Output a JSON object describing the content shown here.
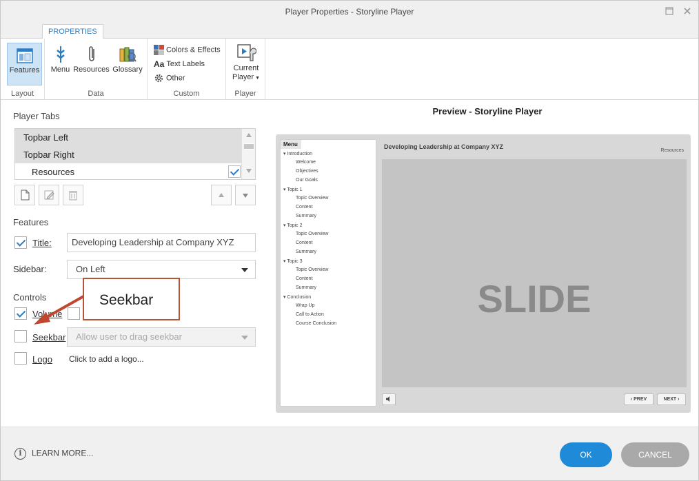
{
  "window": {
    "title": "Player Properties - Storyline Player"
  },
  "ribbon": {
    "tab": "PROPERTIES",
    "groups": {
      "layout": {
        "label": "Layout",
        "features": "Features"
      },
      "data": {
        "label": "Data",
        "menu": "Menu",
        "resources": "Resources",
        "glossary": "Glossary"
      },
      "custom": {
        "label": "Custom",
        "colors": "Colors & Effects",
        "text_labels": "Text Labels",
        "other": "Other"
      },
      "player": {
        "label": "Player",
        "current_line1": "Current",
        "current_line2": "Player"
      }
    }
  },
  "player_tabs": {
    "heading": "Player Tabs",
    "items": [
      {
        "label": "Topbar Left"
      },
      {
        "label": "Topbar Right"
      },
      {
        "label": "Resources"
      }
    ]
  },
  "features": {
    "heading": "Features",
    "title_label": "Title:",
    "title_value": "Developing Leadership at Company XYZ",
    "sidebar_label": "Sidebar:",
    "sidebar_value": "On Left"
  },
  "controls": {
    "heading": "Controls",
    "volume_label": "Volume",
    "seekbar_label": "Seekbar",
    "seekbar_option": "Allow user to drag seekbar",
    "logo_label": "Logo",
    "logo_hint": "Click to add a logo..."
  },
  "callout": {
    "text": "Seekbar"
  },
  "preview": {
    "heading": "Preview - Storyline Player",
    "menu_header": "Menu",
    "course_title": "Developing Leadership at Company XYZ",
    "resources_link": "Resources",
    "slide_text": "SLIDE",
    "prev": "PREV",
    "next": "NEXT",
    "menu": [
      {
        "label": "Introduction",
        "children": [
          "Welcome",
          "Objectives",
          "Our Goals"
        ]
      },
      {
        "label": "Topic 1",
        "children": [
          "Topic Overview",
          "Content",
          "Summary"
        ]
      },
      {
        "label": "Topic 2",
        "children": [
          "Topic Overview",
          "Content",
          "Summary"
        ]
      },
      {
        "label": "Topic 3",
        "children": [
          "Topic Overview",
          "Content",
          "Summary"
        ]
      },
      {
        "label": "Conclusion",
        "children": [
          "Wrap Up",
          "Call to Action",
          "Course Conclusion"
        ]
      }
    ]
  },
  "footer": {
    "learn_more": "LEARN MORE...",
    "ok": "OK",
    "cancel": "CANCEL"
  },
  "colors": {
    "accent": "#2b7cc4",
    "ok_button": "#1f8ad7",
    "cancel_button": "#a9a9a9",
    "callout_border": "#b5543b",
    "arrow": "#c0462f"
  }
}
